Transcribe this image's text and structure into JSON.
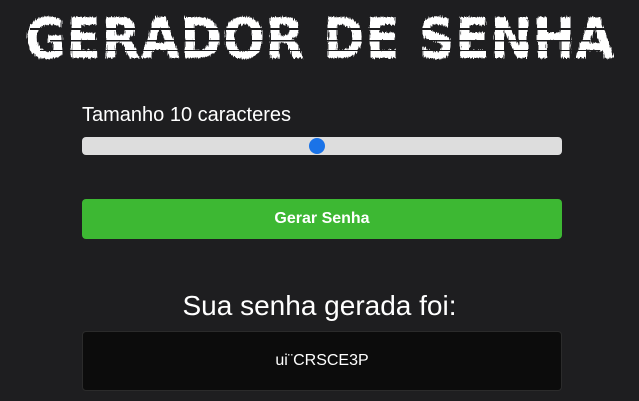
{
  "app": {
    "title": "GERADOR DE SENHA"
  },
  "length": {
    "label": "Tamanho 10 caracteres",
    "value": 10,
    "slider_fraction": 0.49
  },
  "generate_button": {
    "label": "Gerar Senha"
  },
  "result": {
    "title": "Sua senha gerada foi:",
    "password": "ui¨CRSCE3P"
  },
  "colors": {
    "background": "#1e1e20",
    "accent_green": "#3db833",
    "slider_thumb": "#1a73e8",
    "slider_track": "#dddddd",
    "password_box": "#0c0c0c"
  }
}
